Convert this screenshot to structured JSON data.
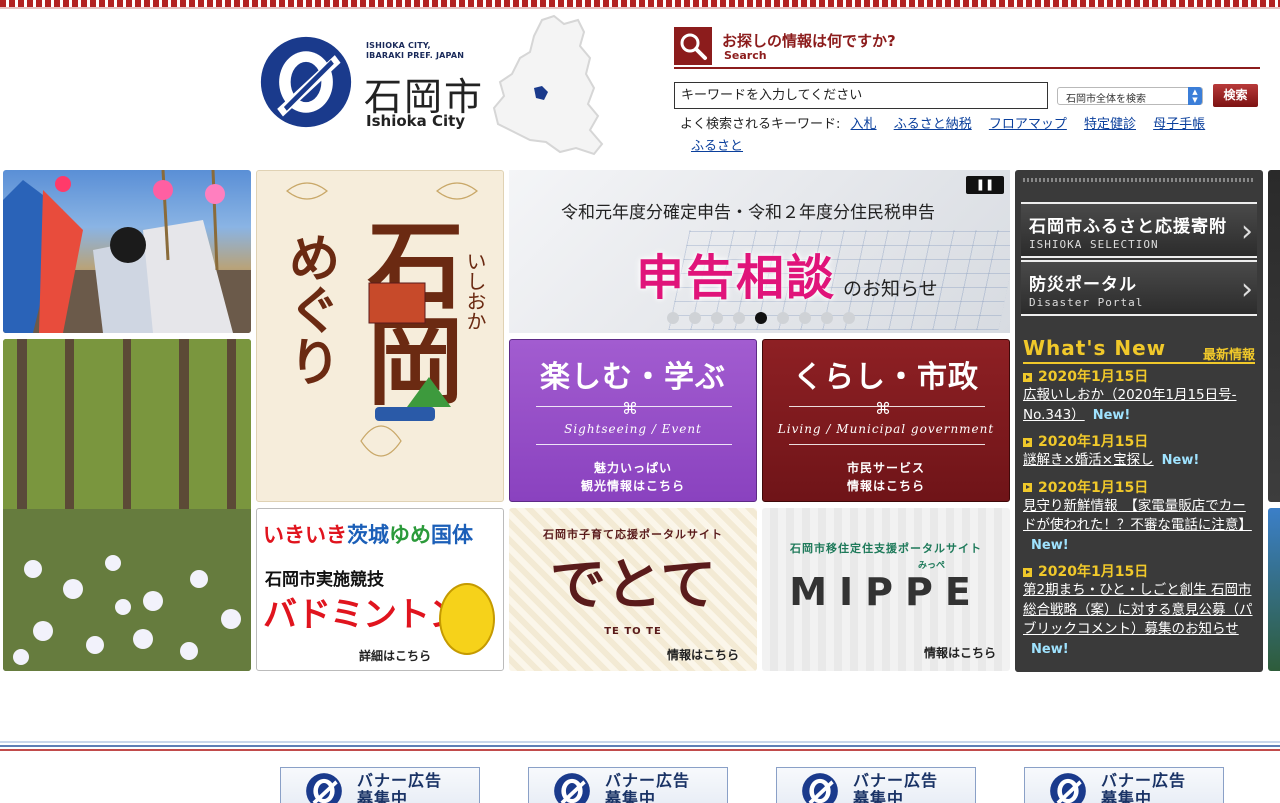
{
  "header": {
    "logo": {
      "en_small_line1": "ISHIOKA CITY,",
      "en_small_line2": "IBARAKI PREF. JAPAN",
      "ja": "石岡市",
      "en": "Ishioka City"
    }
  },
  "search": {
    "title": "お探しの情報は何ですか?",
    "subtitle": "Search",
    "placeholder": "キーワードを入力してください",
    "scope_selected": "石岡市全体を検索",
    "button_label": "検索",
    "keywords_label": "よく検索されるキーワード:",
    "keywords": [
      "入札",
      "ふるさと納税",
      "フロアマップ",
      "特定健診",
      "母子手帳",
      "ふるさと"
    ]
  },
  "tiles": {
    "meguri": {
      "line_a": "めぐり",
      "line_b": "石岡",
      "ruby": "いしおか"
    },
    "slider": {
      "line1": "令和元年度分確定申告・令和２年度分住民税申告",
      "line2": "申告相談",
      "line3": "のお知らせ",
      "pause_symbol": "❚❚",
      "slide_count": 9,
      "active_index": 4
    },
    "tanoshimu": {
      "title": "楽しむ・学ぶ",
      "en": "Sightseeing / Event",
      "sub1": "魅力いっぱい",
      "sub2": "観光情報はこちら"
    },
    "kurashi": {
      "title": "くらし・市政",
      "en": "Living / Municipal government",
      "sub1": "市民サービス",
      "sub2": "情報はこちら"
    },
    "kokutai": {
      "title_a": "いきいき",
      "title_b": "茨城",
      "title_c": "ゆめ",
      "title_d": "国体",
      "sub": "石岡市実施競技",
      "big": "バドミントン",
      "more": "詳細はこちら"
    },
    "detote": {
      "head": "石岡市子育て応援ポータルサイト",
      "logo": "でとて",
      "en": "TE TO TE",
      "more": "情報はこちら"
    },
    "mippe": {
      "head": "石岡市移住定住支援ポータルサイト",
      "logo": "MIPPE",
      "kana": "みっぺ",
      "more": "情報はこちら"
    }
  },
  "right_panel": {
    "links": [
      {
        "ja": "石岡市ふるさと応援寄附",
        "en": "ISHIOKA SELECTION"
      },
      {
        "ja": "防災ポータル",
        "en": "Disaster Portal"
      }
    ],
    "whats_new_label": "What's New",
    "whats_new_ja": "最新情報",
    "new_badge": "New!",
    "news": [
      {
        "date": "2020年1月15日",
        "title": "広報いしおか（2020年1月15日号-No.343）"
      },
      {
        "date": "2020年1月15日",
        "title": "謎解き×婚活×宝探し"
      },
      {
        "date": "2020年1月15日",
        "title": "見守り新鮮情報　【家電量販店でカードが使われた！？不審な電話に注意】"
      },
      {
        "date": "2020年1月15日",
        "title": "第2期まち・ひと・しごと創生 石岡市総合戦略（案）に対する意見公募（パブリックコメント）募集のお知らせ"
      }
    ]
  },
  "footer": {
    "banners": [
      {
        "line1": "バナー広告",
        "line2": "募集中"
      },
      {
        "line1": "バナー広告",
        "line2": "募集中"
      },
      {
        "line1": "バナー広告",
        "line2": "募集中"
      },
      {
        "line1": "バナー広告",
        "line2": "募集中"
      }
    ]
  },
  "colors": {
    "brand_red": "#8c1c1c",
    "brand_blue": "#1a3a8c",
    "news_yellow": "#f0c82a",
    "slider_pink": "#e0147a"
  },
  "icons": {
    "search": "magnifier-icon",
    "scope_arrow": "updown-arrow-icon",
    "chevron": "chevron-right-icon",
    "pause": "pause-icon"
  }
}
